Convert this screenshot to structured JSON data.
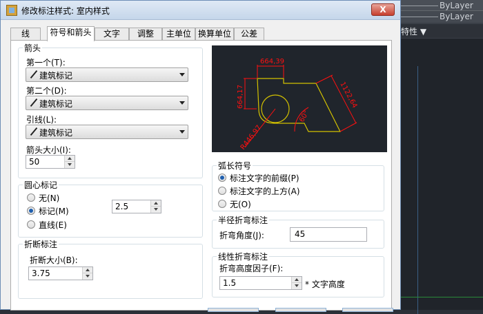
{
  "background_app": {
    "layer_row1": "ByLayer",
    "layer_row2": "ByLayer",
    "properties_label": "特性 ▼"
  },
  "dialog": {
    "title": "修改标注样式: 室内样式",
    "close_glyph": "X",
    "tabs": [
      {
        "label": "线",
        "active": false
      },
      {
        "label": "符号和箭头",
        "active": true
      },
      {
        "label": "文字",
        "active": false
      },
      {
        "label": "调整",
        "active": false
      },
      {
        "label": "主单位",
        "active": false
      },
      {
        "label": "换算单位",
        "active": false
      },
      {
        "label": "公差",
        "active": false
      }
    ]
  },
  "arrowheads": {
    "title": "箭头",
    "first_label": "第一个(T):",
    "first_value": "建筑标记",
    "second_label": "第二个(D):",
    "second_value": "建筑标记",
    "leader_label": "引线(L):",
    "leader_value": "建筑标记",
    "size_label": "箭头大小(I):",
    "size_value": "50"
  },
  "center_marks": {
    "title": "圆心标记",
    "options": [
      {
        "label": "无(N)",
        "checked": false
      },
      {
        "label": "标记(M)",
        "checked": true
      },
      {
        "label": "直线(E)",
        "checked": false
      }
    ],
    "size_value": "2.5"
  },
  "dimension_break": {
    "title": "折断标注",
    "size_label": "折断大小(B):",
    "size_value": "3.75"
  },
  "preview": {
    "dim_top": "664,39",
    "dim_left": "664,17",
    "dim_right": "1122,64",
    "dim_angle": "60°",
    "dim_radius": "R446,97"
  },
  "arc_length": {
    "title": "弧长符号",
    "options": [
      {
        "label": "标注文字的前缀(P)",
        "checked": true
      },
      {
        "label": "标注文字的上方(A)",
        "checked": false
      },
      {
        "label": "无(O)",
        "checked": false
      }
    ]
  },
  "radius_jog": {
    "title": "半径折弯标注",
    "angle_label": "折弯角度(J):",
    "angle_value": "45"
  },
  "linear_jog": {
    "title": "线性折弯标注",
    "factor_label": "折弯高度因子(F):",
    "factor_value": "1.5",
    "unit_label": "* 文字高度"
  },
  "colors": {
    "preview_bg": "#20252c",
    "geometry": "#d4c200",
    "dimension": "#ff1010",
    "selected_radio": "#1f5fae"
  }
}
